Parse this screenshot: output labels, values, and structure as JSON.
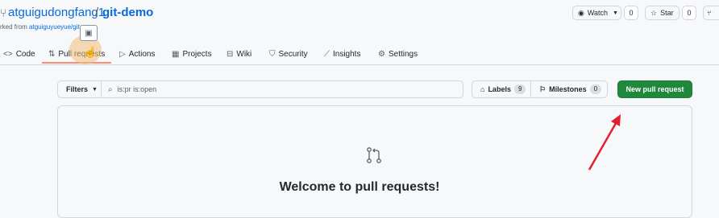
{
  "repo": {
    "owner": "atguigudongfang1",
    "separator": "/",
    "name": "git-demo",
    "forked_prefix": "rked from ",
    "forked_link": "atguiguyueyue/git-"
  },
  "header_buttons": {
    "watch_label": "Watch",
    "watch_count": "0",
    "star_label": "Star",
    "star_count": "0"
  },
  "tabs": [
    {
      "label": "Code",
      "icon": "code-icon"
    },
    {
      "label": "Pull requests",
      "icon": "git-pull-request-icon"
    },
    {
      "label": "Actions",
      "icon": "play-icon"
    },
    {
      "label": "Projects",
      "icon": "table-icon"
    },
    {
      "label": "Wiki",
      "icon": "book-icon"
    },
    {
      "label": "Security",
      "icon": "shield-icon"
    },
    {
      "label": "Insights",
      "icon": "graph-icon"
    },
    {
      "label": "Settings",
      "icon": "gear-icon"
    }
  ],
  "toolbar": {
    "filters_label": "Filters",
    "search_value": "is:pr is:open",
    "labels_label": "Labels",
    "labels_count": "9",
    "milestones_label": "Milestones",
    "milestones_count": "0",
    "new_pr_label": "New pull request"
  },
  "blankslate": {
    "title": "Welcome to pull requests!"
  },
  "colors": {
    "primary_button": "#1f883d",
    "link": "#0969da",
    "annotation_arrow": "#e0202a"
  }
}
